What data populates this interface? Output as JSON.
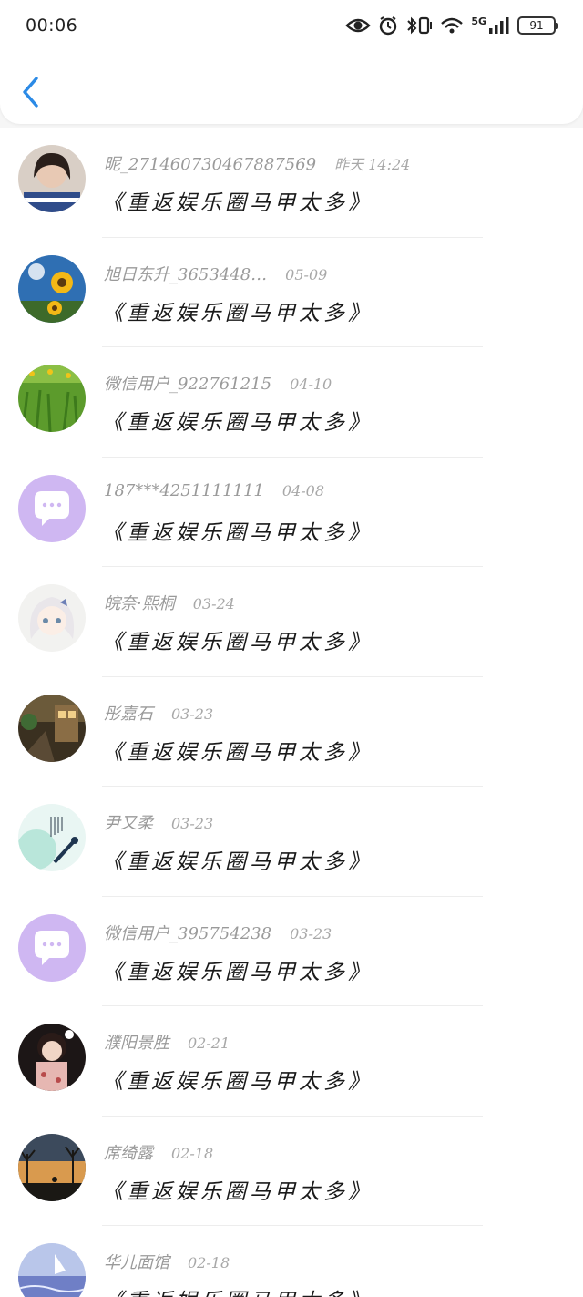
{
  "status_bar": {
    "time": "00:06",
    "network": "5G",
    "battery": "91"
  },
  "colors": {
    "accent": "#2b8ae6",
    "default_avatar": "#cfb7f2"
  },
  "messages": [
    {
      "name": "昵_2714607304678875​69",
      "date": "昨天 14:24",
      "text": "《重返娱乐圈马甲太多》",
      "avatar": "photo-girl-avatar"
    },
    {
      "name": "旭日东升_3653448…",
      "date": "05-09",
      "text": "《重返娱乐圈马甲太多》",
      "avatar": "sunflower-avatar"
    },
    {
      "name": "微信用户_922761215",
      "date": "04-10",
      "text": "《重返娱乐圈马甲太多》",
      "avatar": "grass-avatar"
    },
    {
      "name": "187***4251111111",
      "date": "04-08",
      "text": "《重返娱乐圈马甲太多》",
      "avatar": "default-chat-avatar"
    },
    {
      "name": "皖奈·熙桐",
      "date": "03-24",
      "text": "《重返娱乐圈马甲太多》",
      "avatar": "anime-girl-avatar"
    },
    {
      "name": "彤嘉石",
      "date": "03-23",
      "text": "《重返娱乐圈马甲太多》",
      "avatar": "street-avatar"
    },
    {
      "name": "尹又柔",
      "date": "03-23",
      "text": "《重返娱乐圈马甲太多》",
      "avatar": "poem-avatar"
    },
    {
      "name": "微信用户_395754238",
      "date": "03-23",
      "text": "《重返娱乐圈马甲太多》",
      "avatar": "default-chat-avatar"
    },
    {
      "name": "濮阳景胜",
      "date": "02-21",
      "text": "《重返娱乐圈马甲太多》",
      "avatar": "portrait-avatar"
    },
    {
      "name": "席绮露",
      "date": "02-18",
      "text": "《重返娱乐圈马甲太多》",
      "avatar": "sunset-avatar"
    },
    {
      "name": "华儿面馆",
      "date": "02-18",
      "text": "《重返娱乐圈马甲太多》",
      "avatar": "sea-avatar"
    }
  ]
}
